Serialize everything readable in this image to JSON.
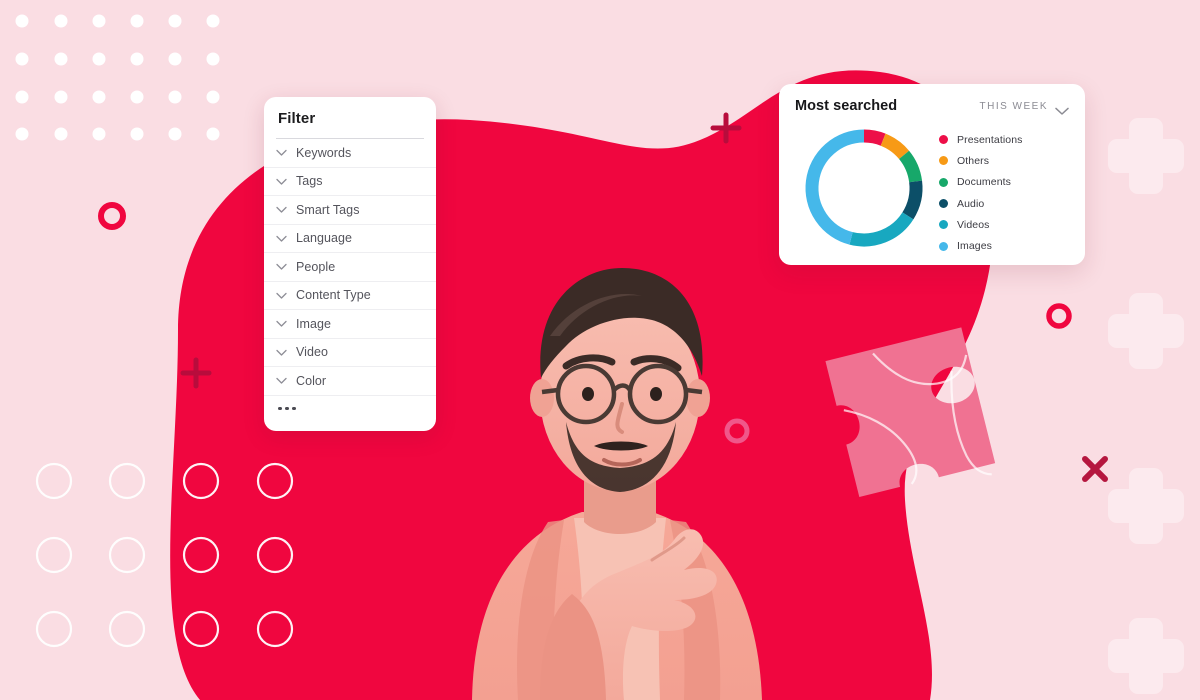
{
  "page": {
    "background_color": "#fadde3",
    "blob_color": "#f0063f",
    "accent_color": "#f0063f"
  },
  "filter_panel": {
    "title": "Filter",
    "more_label": "...",
    "items": [
      {
        "label": "Keywords",
        "icon": "chevron-down-icon"
      },
      {
        "label": "Tags",
        "icon": "chevron-down-icon"
      },
      {
        "label": "Smart Tags",
        "icon": "chevron-down-icon"
      },
      {
        "label": "Language",
        "icon": "chevron-down-icon"
      },
      {
        "label": "People",
        "icon": "chevron-down-icon"
      },
      {
        "label": "Content Type",
        "icon": "chevron-down-icon"
      },
      {
        "label": "Image",
        "icon": "chevron-down-icon"
      },
      {
        "label": "Video",
        "icon": "chevron-down-icon"
      },
      {
        "label": "Color",
        "icon": "chevron-down-icon"
      }
    ]
  },
  "most_searched_card": {
    "title": "Most searched",
    "period": "THIS WEEK",
    "period_icon": "chevron-down-icon"
  },
  "chart_data": {
    "type": "pie",
    "title": "Most searched",
    "subtitle": "THIS WEEK",
    "legend_position": "right",
    "donut": true,
    "categories": [
      "Presentations",
      "Others",
      "Documents",
      "Audio",
      "Videos",
      "Images"
    ],
    "values": [
      6,
      8,
      9,
      11,
      20,
      46
    ],
    "colors": [
      "#ed0f48",
      "#f79a16",
      "#17a86a",
      "#0c4f68",
      "#18a8c0",
      "#45b8ea"
    ],
    "series": [
      {
        "name": "Most searched",
        "values": [
          6,
          8,
          9,
          11,
          20,
          46
        ]
      }
    ],
    "legend": [
      {
        "label": "Presentations",
        "color": "#ed0f48",
        "value": 6
      },
      {
        "label": "Others",
        "color": "#f79a16",
        "value": 8
      },
      {
        "label": "Documents",
        "color": "#17a86a",
        "value": 9
      },
      {
        "label": "Audio",
        "color": "#0c4f68",
        "value": 11
      },
      {
        "label": "Videos",
        "color": "#18a8c0",
        "value": 20
      },
      {
        "label": "Images",
        "color": "#45b8ea",
        "value": 46
      }
    ],
    "xlabel": "",
    "ylabel": ""
  },
  "decorations": {
    "dot_grid": "white-dot-grid",
    "circle_grid": "white-circle-outline-grid",
    "plus_marks": "plus-icon",
    "x_mark": "close-icon",
    "ring_marks": "ring-icon",
    "puzzle": "puzzle-piece-icon",
    "person": "person-thinking-photo"
  }
}
